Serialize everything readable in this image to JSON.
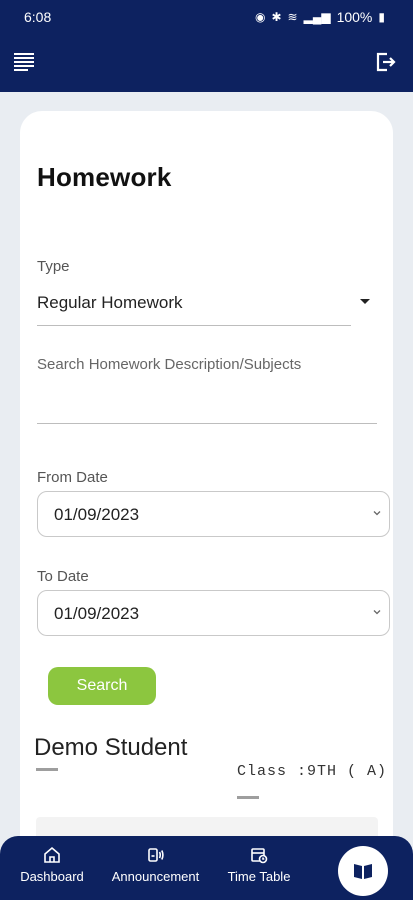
{
  "status_bar": {
    "time": "6:08",
    "battery": "100%"
  },
  "app_bar": {
    "menu_icon": "menu-icon",
    "logout_icon": "logout-icon"
  },
  "page": {
    "title": "Homework"
  },
  "form": {
    "type_label": "Type",
    "type_value": "Regular Homework",
    "search_placeholder": "Search Homework Description/Subjects",
    "search_value": "",
    "from_date_label": "From Date",
    "from_date_value": "01/09/2023",
    "to_date_label": "To Date",
    "to_date_value": "01/09/2023",
    "search_button_label": "Search"
  },
  "student": {
    "name": "Demo Student",
    "class_text": "Class :9TH ( A)"
  },
  "bottom_nav": {
    "items": [
      {
        "label": "Dashboard",
        "icon": "home-icon"
      },
      {
        "label": "Announcement",
        "icon": "announcement-icon"
      },
      {
        "label": "Time Table",
        "icon": "timetable-icon"
      }
    ],
    "fab_icon": "book-icon"
  },
  "colors": {
    "primary": "#0d2260",
    "accent": "#8cc63f",
    "background": "#e9edf2"
  }
}
